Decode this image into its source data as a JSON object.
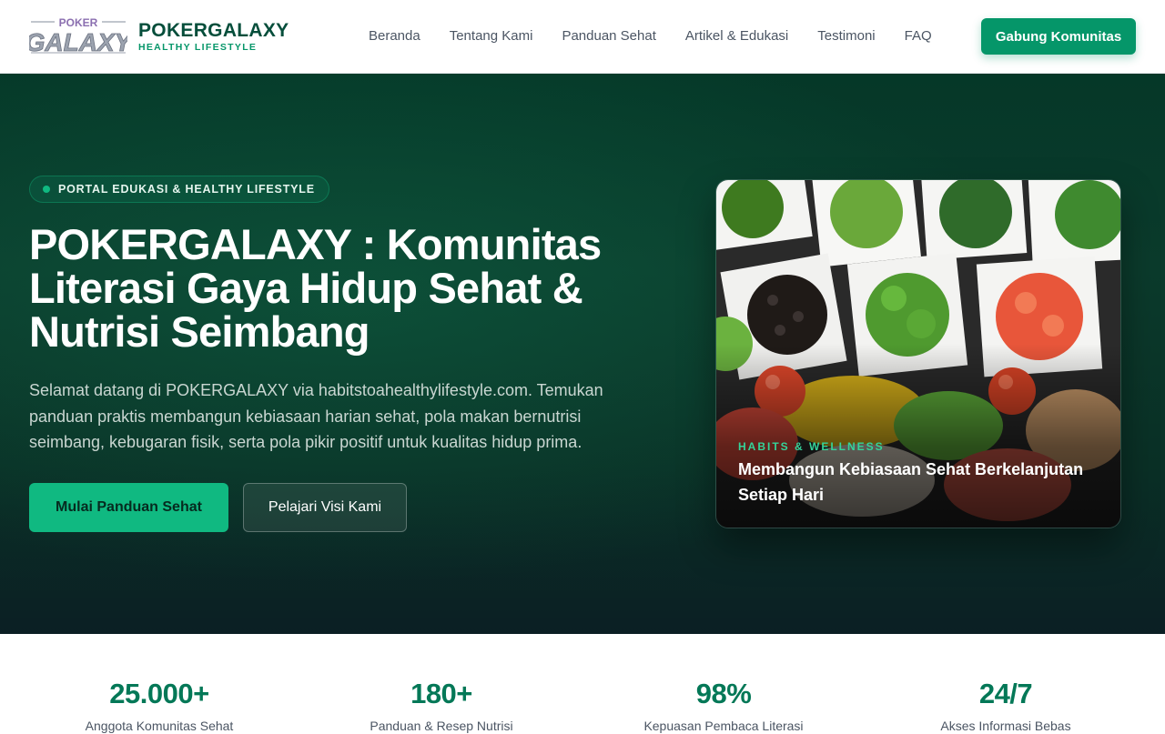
{
  "header": {
    "logo_text_top": "POKER",
    "logo_text_main": "GALAXY",
    "brand_name": "POKERGALAXY",
    "brand_tagline": "HEALTHY LIFESTYLE",
    "nav": [
      "Beranda",
      "Tentang Kami",
      "Panduan Sehat",
      "Artikel & Edukasi",
      "Testimoni",
      "FAQ"
    ],
    "cta": "Gabung Komunitas"
  },
  "hero": {
    "badge": "PORTAL EDUKASI & HEALTHY LIFESTYLE",
    "title": "POKERGALAXY : Komunitas Literasi Gaya Hidup Sehat & Nutrisi Seimbang",
    "description": "Selamat datang di POKERGALAXY via habitstoahealthylifestyle.com. Temukan panduan praktis membangun kebiasaan harian sehat, pola makan bernutrisi seimbang, kebugaran fisik, serta pola pikir positif untuk kualitas hidup prima.",
    "primary_button": "Mulai Panduan Sehat",
    "secondary_button": "Pelajari Visi Kami",
    "image_icon": "vegetable-platter-image",
    "image_kicker": "HABITS & WELLNESS",
    "image_caption": "Membangun Kebiasaan Sehat Berkelanjutan Setiap Hari"
  },
  "stats": [
    {
      "value": "25.000+",
      "label": "Anggota Komunitas Sehat"
    },
    {
      "value": "180+",
      "label": "Panduan & Resep Nutrisi"
    },
    {
      "value": "98%",
      "label": "Kepuasan Pembaca Literasi"
    },
    {
      "value": "24/7",
      "label": "Akses Informasi Bebas"
    }
  ],
  "colors": {
    "accent": "#10b981",
    "brand_dark": "#064e3b",
    "hero_bg": "#0b3b2c",
    "stat_value": "#047857"
  }
}
